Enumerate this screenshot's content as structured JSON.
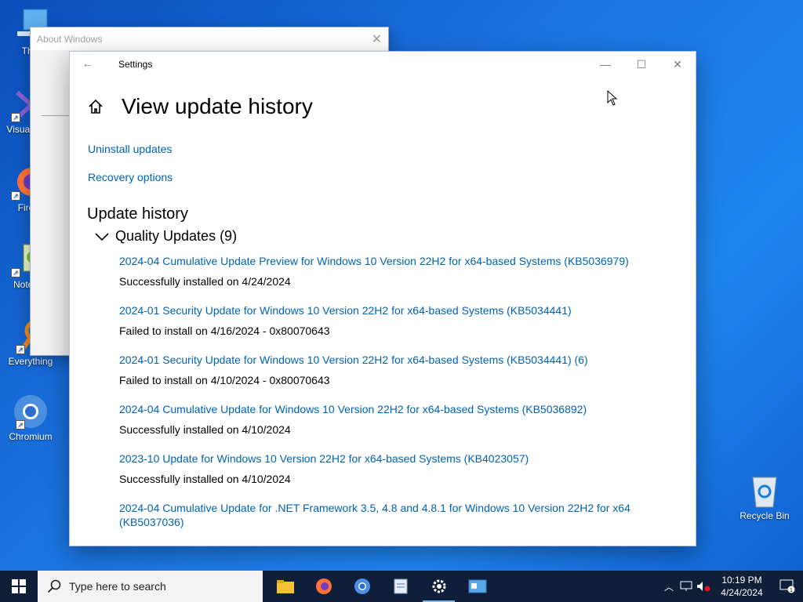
{
  "desktop": {
    "icons": [
      {
        "label": "This",
        "icon": "this-pc-icon"
      },
      {
        "label": "Visual 20",
        "icon": "visual-studio-icon"
      },
      {
        "label": "Fire",
        "icon": "firefox-icon"
      },
      {
        "label": "Notep",
        "icon": "notepad-icon"
      },
      {
        "label": "Everything",
        "icon": "everything-icon"
      },
      {
        "label": "Chromium",
        "icon": "chromium-icon"
      },
      {
        "label": "Recycle Bin",
        "icon": "recycle-bin-icon"
      }
    ]
  },
  "about_window": {
    "title": "About Windows"
  },
  "settings": {
    "window_title": "Settings",
    "page_title": "View update history",
    "links": {
      "uninstall": "Uninstall updates",
      "recovery": "Recovery options"
    },
    "section_title": "Update history",
    "group_label": "Quality Updates (9)",
    "updates": [
      {
        "name": "2024-04 Cumulative Update Preview for Windows 10 Version 22H2 for x64-based Systems (KB5036979)",
        "status": "Successfully installed on 4/24/2024"
      },
      {
        "name": "2024-01 Security Update for Windows 10 Version 22H2 for x64-based Systems (KB5034441)",
        "status": "Failed to install on 4/16/2024 - 0x80070643"
      },
      {
        "name": "2024-01 Security Update for Windows 10 Version 22H2 for x64-based Systems (KB5034441) (6)",
        "status": "Failed to install on 4/10/2024 - 0x80070643"
      },
      {
        "name": "2024-04 Cumulative Update for Windows 10 Version 22H2 for x64-based Systems (KB5036892)",
        "status": "Successfully installed on 4/10/2024"
      },
      {
        "name": "2023-10 Update for Windows 10 Version 22H2 for x64-based Systems (KB4023057)",
        "status": "Successfully installed on 4/10/2024"
      },
      {
        "name": "2024-04 Cumulative Update for .NET Framework 3.5, 4.8 and 4.8.1 for Windows 10 Version 22H2 for x64 (KB5037036)",
        "status": ""
      }
    ]
  },
  "taskbar": {
    "search_placeholder": "Type here to search",
    "time": "10:19 PM",
    "date": "4/24/2024",
    "notification_count": "1"
  },
  "colors": {
    "link": "#0063b1",
    "taskbar": "#0f1f3a",
    "desktop": "#1a73e0"
  }
}
